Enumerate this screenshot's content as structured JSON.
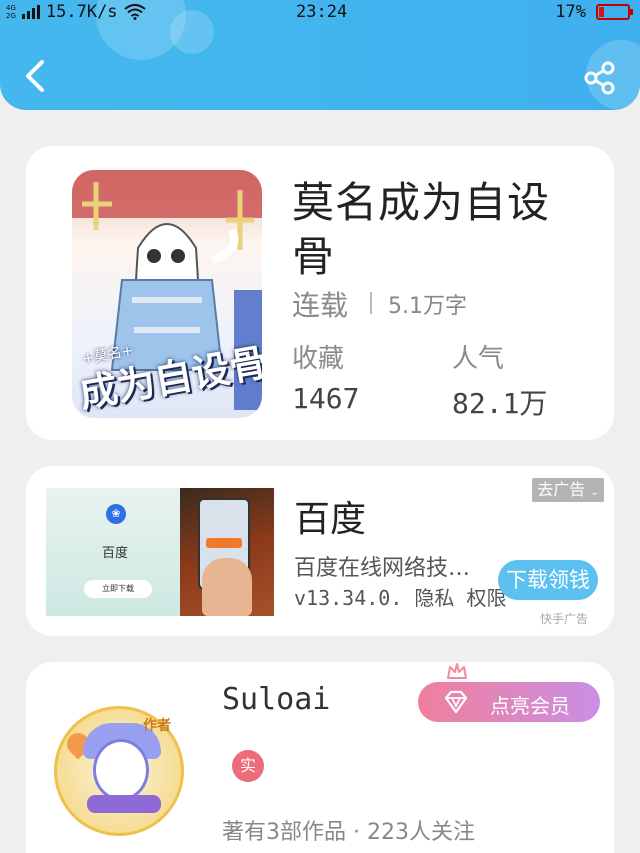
{
  "status_bar": {
    "network_top": "4G",
    "network_bottom": "2G",
    "speed": "15.7K/s",
    "time": "23:24",
    "battery": "17%"
  },
  "header": {
    "back_icon": "back-chevron-icon",
    "share_icon": "share-icon",
    "accent": "#44b8ee"
  },
  "book": {
    "cover_title": "成为自设骨",
    "cover_subtitle": "+莫名+",
    "title": "莫名成为自设骨",
    "status": "连载",
    "word_count": "5.1万字",
    "favorites_label": "收藏",
    "favorites_value": "1467",
    "popularity_label": "人气",
    "popularity_value": "82.1万"
  },
  "ad": {
    "image_app_name": "百度",
    "image_download_label": "立即下载",
    "title": "百度",
    "description": "百度在线网络技…",
    "meta": "v13.34.0. 隐私 权限",
    "close_label": "去广告",
    "download_button": "下载领钱",
    "source": "快手广告"
  },
  "author": {
    "avatar_tag": "作者",
    "name": "Suloai",
    "verified_label": "实",
    "stats": "著有3部作品 · 223人关注",
    "vip_button": "点亮会员",
    "vip_gradient": [
      "#f17f9a",
      "#c98fe5"
    ]
  }
}
